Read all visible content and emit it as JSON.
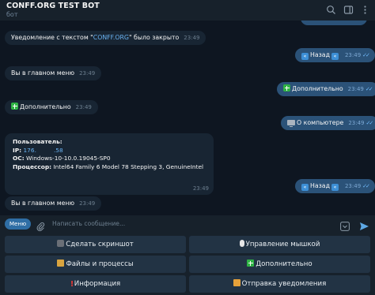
{
  "header": {
    "title": "CONFF.ORG TEST BOT",
    "subtitle": "бот",
    "icons": [
      "search-icon",
      "sidebar-toggle-icon",
      "more-icon"
    ]
  },
  "messages": [
    {
      "dir": "in",
      "prefix": "Уведомление с текстом \"",
      "link": "CONFF.ORG",
      "suffix": "\" было закрыто",
      "time": "23:49"
    },
    {
      "dir": "out",
      "icon": "back-icon",
      "text": "Назад",
      "icon_after": "back-icon",
      "time": "23:49",
      "ticks": "✓✓"
    },
    {
      "dir": "in",
      "text": "Вы в главном меню",
      "time": "23:49"
    },
    {
      "dir": "out",
      "icon": "plus-icon",
      "text": "Дополнительно",
      "time": "23:49",
      "ticks": "✓✓"
    },
    {
      "dir": "in",
      "icon": "plus-icon",
      "text": "Дополнительно",
      "time": "23:49"
    },
    {
      "dir": "out",
      "icon": "computer-icon",
      "text": "О компьютере",
      "time": "23:49",
      "ticks": "✓✓"
    },
    {
      "dir": "out",
      "icon": "back-icon",
      "text": "Назад",
      "icon_after": "back-icon",
      "time": "23:49",
      "ticks": "✓✓"
    },
    {
      "dir": "in",
      "text": "Вы в главном меню",
      "time": "23:49"
    }
  ],
  "info": {
    "heading": "Пользователь:",
    "ip_label": "IP:",
    "ip_value_start": "176.",
    "ip_value_end": ".58",
    "os_label": "ОС:",
    "os_value": "Windows-10-10.0.19045-SP0",
    "cpu_label": "Процессор:",
    "cpu_value": "Intel64 Family 6 Model 78 Stepping 3, GenuineIntel",
    "time": "23:49"
  },
  "composer": {
    "menu_label": "Меню",
    "placeholder": "Написать сообщение..."
  },
  "keyboard": [
    {
      "icon": "camera-icon",
      "label": "Сделать скриншот"
    },
    {
      "icon": "mouse-icon",
      "label": "Управление мышкой"
    },
    {
      "icon": "folder-icon",
      "label": "Файлы и процессы"
    },
    {
      "icon": "plus-icon",
      "label": "Дополнительно"
    },
    {
      "icon": "exclamation-icon",
      "label": "Информация"
    },
    {
      "icon": "mail-icon",
      "label": "Отправка уведомления"
    }
  ],
  "colors": {
    "background": "#0e1621",
    "panel": "#17212b",
    "incoming": "#182533",
    "outgoing": "#2b5278",
    "link": "#6ab3f3",
    "button": "#223344",
    "menu_button": "#2f6ea5"
  }
}
